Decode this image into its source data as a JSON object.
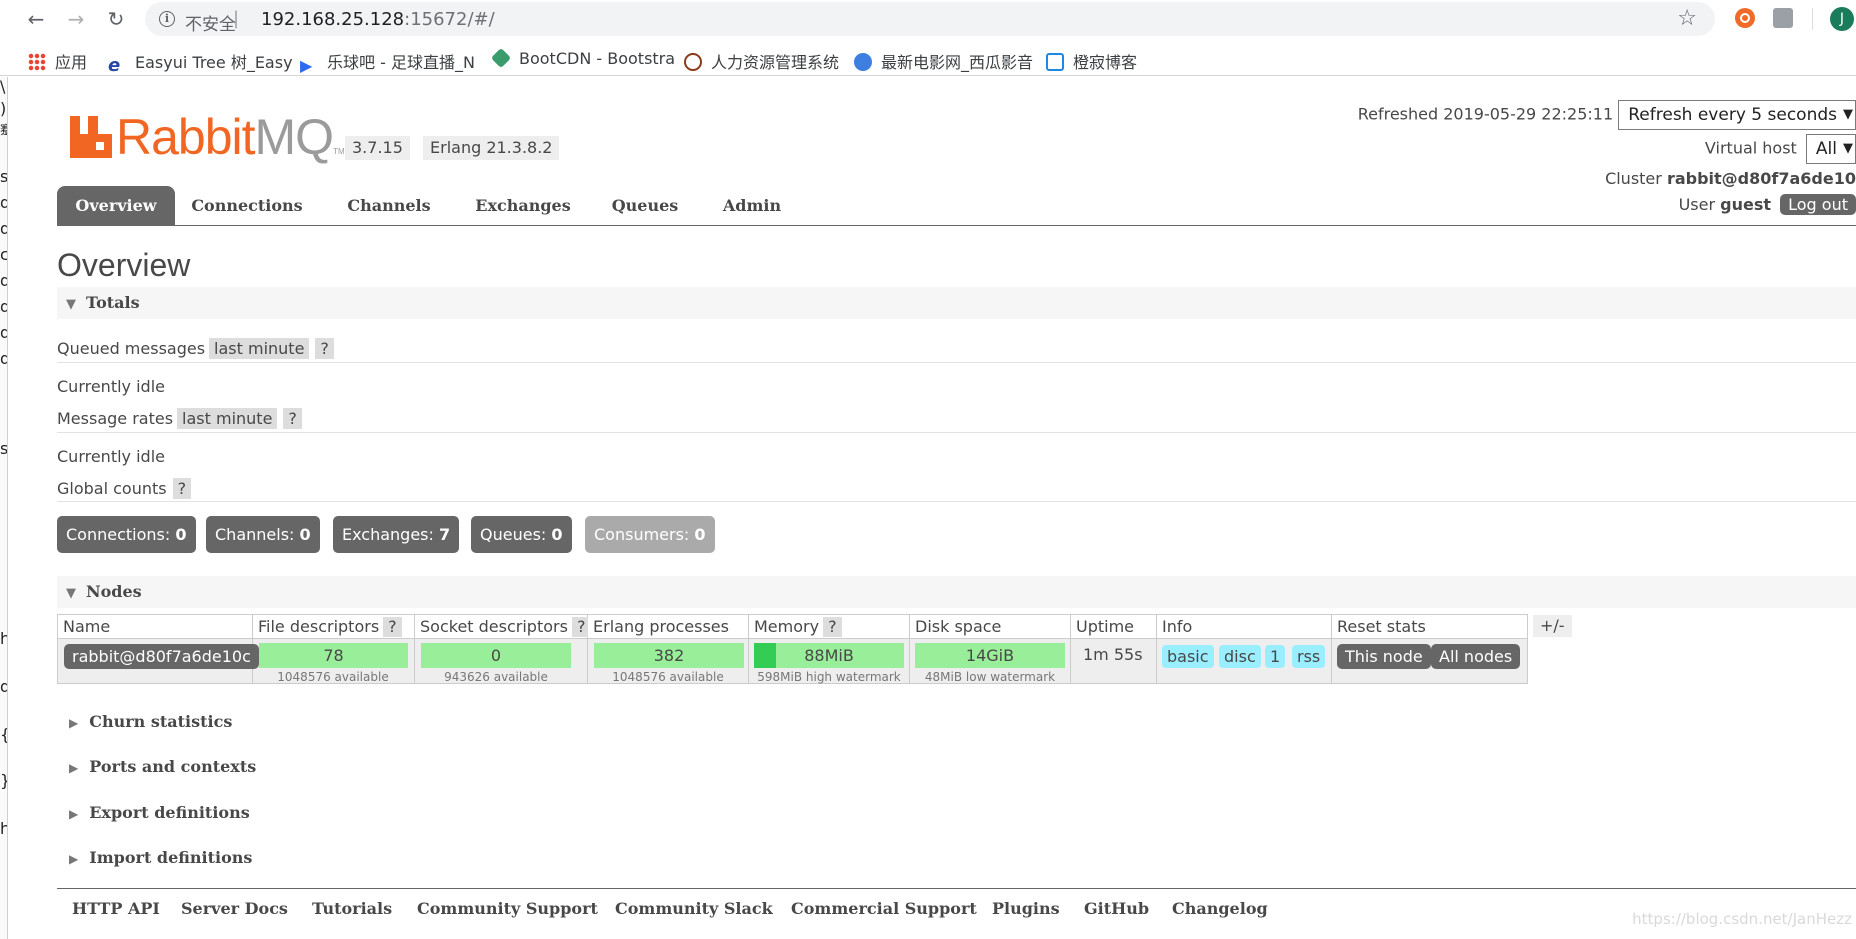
{
  "browser": {
    "insecure_label": "不安全",
    "separator": "|",
    "url_host": "192.168.25.128",
    "url_rest": ":15672/#/",
    "profile_initial": "J",
    "bookmarks": [
      {
        "label": "应用"
      },
      {
        "label": "Easyui Tree 树_Easy"
      },
      {
        "label": "乐球吧 - 足球直播_N"
      },
      {
        "label": "BootCDN - Bootstra"
      },
      {
        "label": "人力资源管理系统"
      },
      {
        "label": "最新电影网_西瓜影音"
      },
      {
        "label": "橙寂博客"
      }
    ],
    "left_strip_chars": [
      "\\",
      ")",
      "蹇",
      "s",
      "d",
      "d",
      "c",
      "d",
      "d",
      "d",
      "d",
      "s",
      "h",
      "d",
      "{",
      "}",
      "h"
    ]
  },
  "header": {
    "logo_rabbit": "Rabbit",
    "logo_mq": "MQ",
    "logo_tm": "TM",
    "version": "3.7.15",
    "erlang": "Erlang 21.3.8.2",
    "refreshed_label": "Refreshed 2019-05-29 22:25:11",
    "refresh_option": "Refresh every 5 seconds",
    "vhost_label": "Virtual host",
    "vhost_value": "All",
    "cluster_label": "Cluster",
    "cluster_value": "rabbit@d80f7a6de10",
    "user_label": "User",
    "user_value": "guest",
    "logout_label": "Log out"
  },
  "tabs": [
    "Overview",
    "Connections",
    "Channels",
    "Exchanges",
    "Queues",
    "Admin"
  ],
  "page": {
    "title": "Overview",
    "totals_header": "Totals",
    "queued_label": "Queued messages",
    "queued_chip": "last minute",
    "help": "?",
    "idle1": "Currently idle",
    "rates_label": "Message rates",
    "rates_chip": "last minute",
    "idle2": "Currently idle",
    "global_label": "Global counts",
    "counts": [
      {
        "label": "Connections:",
        "value": "0"
      },
      {
        "label": "Channels:",
        "value": "0"
      },
      {
        "label": "Exchanges:",
        "value": "7"
      },
      {
        "label": "Queues:",
        "value": "0"
      },
      {
        "label": "Consumers:",
        "value": "0"
      }
    ],
    "nodes_header": "Nodes"
  },
  "nodes_table": {
    "headers": {
      "name": "Name",
      "fd": "File descriptors",
      "sd": "Socket descriptors",
      "ep": "Erlang processes",
      "mem": "Memory",
      "disk": "Disk space",
      "uptime": "Uptime",
      "info": "Info",
      "reset": "Reset stats"
    },
    "row": {
      "name": "rabbit@d80f7a6de10c",
      "fd_value": "78",
      "fd_sub": "1048576 available",
      "sd_value": "0",
      "sd_sub": "943626 available",
      "ep_value": "382",
      "ep_sub": "1048576 available",
      "mem_value": "88MiB",
      "mem_sub": "598MiB high watermark",
      "mem_fraction": 0.147,
      "disk_value": "14GiB",
      "disk_sub": "48MiB low watermark",
      "uptime": "1m 55s",
      "info_tags": [
        "basic",
        "disc",
        "1",
        "rss"
      ],
      "reset_this": "This node",
      "reset_all": "All nodes"
    },
    "plus_minus": "+/-"
  },
  "collapsed_sections": [
    "Churn statistics",
    "Ports and contexts",
    "Export definitions",
    "Import definitions"
  ],
  "footer_links": [
    "HTTP API",
    "Server Docs",
    "Tutorials",
    "Community Support",
    "Community Slack",
    "Commercial Support",
    "Plugins",
    "GitHub",
    "Changelog"
  ],
  "watermark": "https://blog.csdn.net/JanHezz",
  "colors": {
    "accent": "#f16622",
    "dark_gray": "#666666",
    "green_bar": "#99ee99",
    "green_fill": "#33cc55",
    "info_blue": "#99eeff"
  }
}
